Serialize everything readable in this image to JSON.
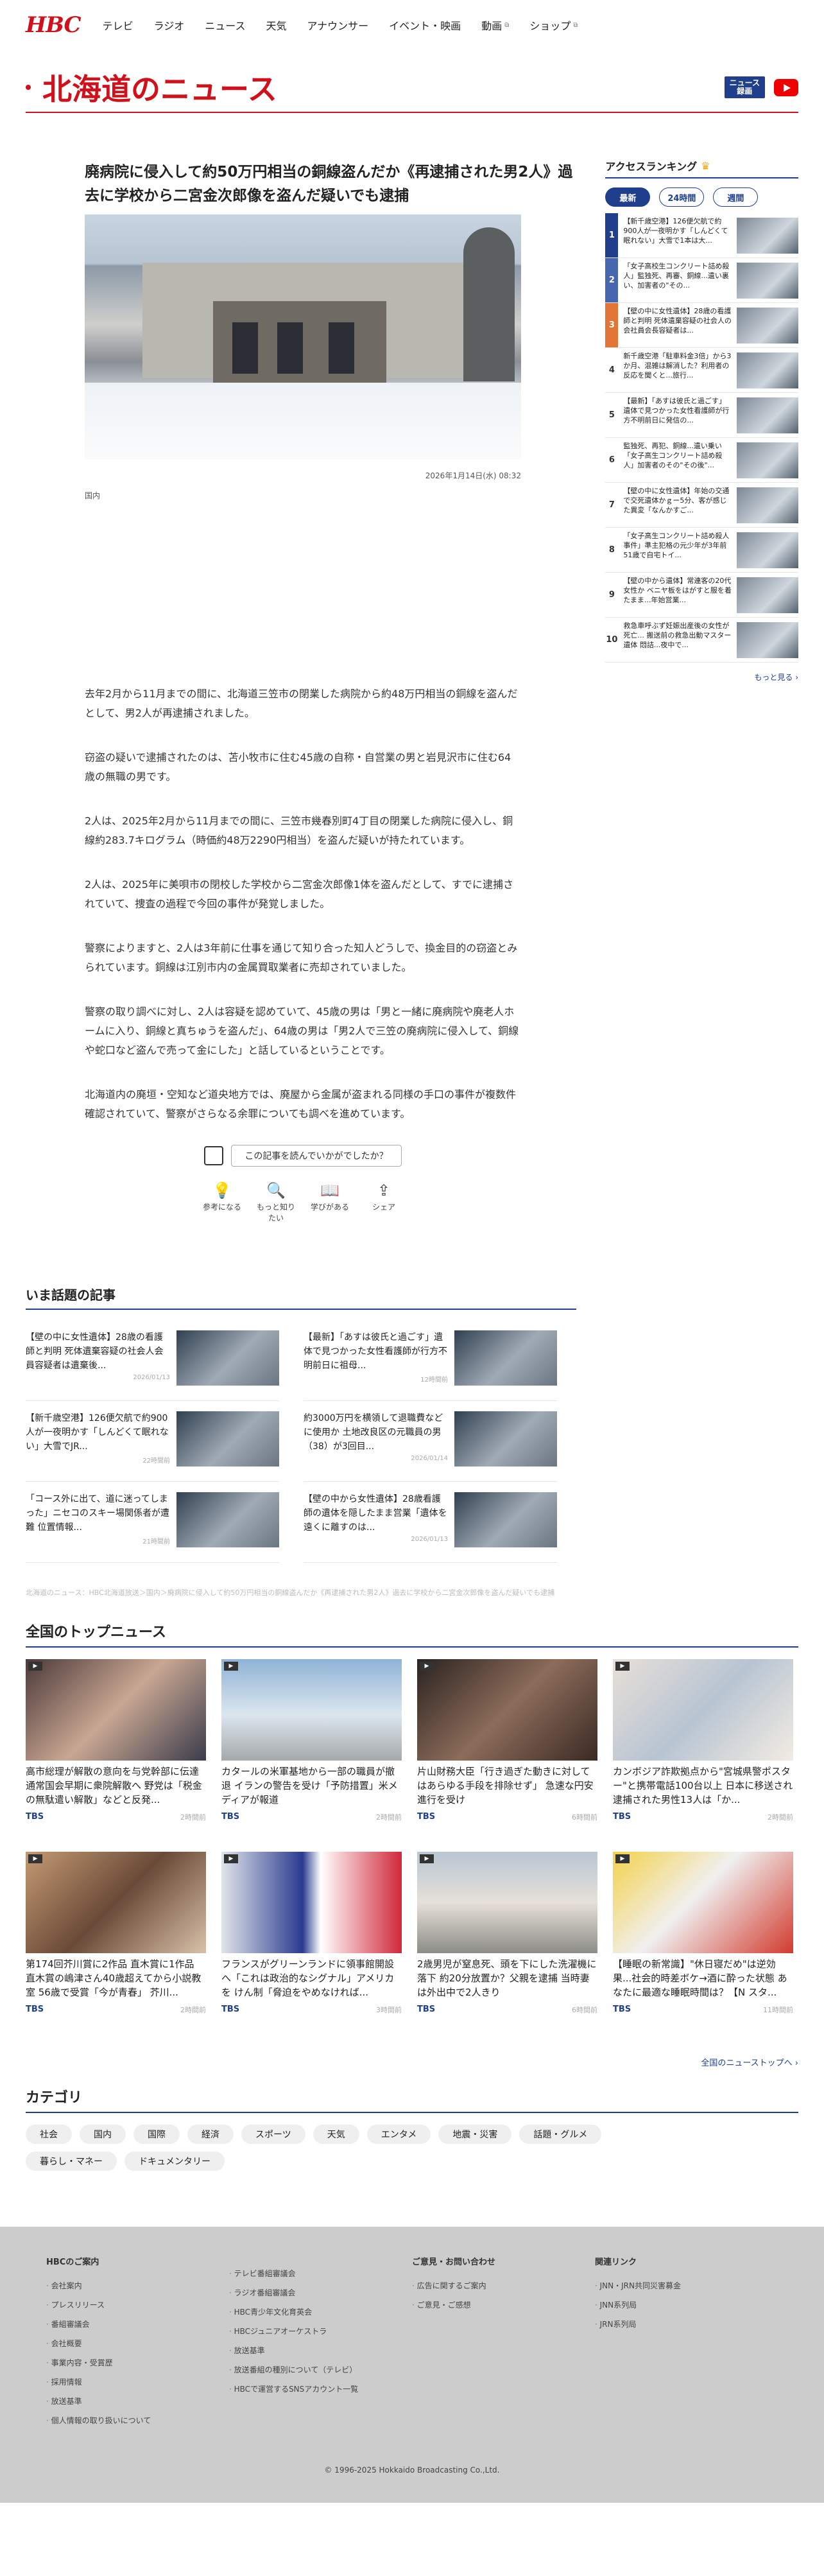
{
  "header": {
    "logo": "HBC",
    "nav": [
      {
        "label": "テレビ",
        "ext": false
      },
      {
        "label": "ラジオ",
        "ext": false
      },
      {
        "label": "ニュース",
        "ext": false
      },
      {
        "label": "天気",
        "ext": false
      },
      {
        "label": "アナウンサー",
        "ext": false
      },
      {
        "label": "イベント・映画",
        "ext": false
      },
      {
        "label": "動画",
        "ext": true
      },
      {
        "label": "ショップ",
        "ext": true
      }
    ],
    "ext_icon": "⧉"
  },
  "page": {
    "title": "北海道のニュース",
    "news_badge_1": "ニュース",
    "news_badge_2": "録画"
  },
  "article": {
    "headline": "廃病院に侵入して約50万円相当の銅線盗んだか《再逮捕された男2人》過去に学校から二宮金次郎像を盗んだ疑いでも逮捕",
    "date": "2026年1月14日(水) 08:32",
    "category": "国内",
    "paragraphs": [
      "去年2月から11月までの間に、北海道三笠市の閉業した病院から約48万円相当の銅線を盗んだとして、男2人が再逮捕されました。",
      "窃盗の疑いで逮捕されたのは、苫小牧市に住む45歳の自称・自営業の男と岩見沢市に住む64歳の無職の男です。",
      "2人は、2025年2月から11月までの間に、三笠市幾春別町4丁目の閉業した病院に侵入し、銅線約283.7キログラム（時価約48万2290円相当）を盗んだ疑いが持たれています。",
      "2人は、2025年に美唄市の閉校した学校から二宮金次郎像1体を盗んだとして、すでに逮捕されていて、捜査の過程で今回の事件が発覚しました。",
      "警察によりますと、2人は3年前に仕事を通じて知り合った知人どうしで、換金目的の窃盗とみられています。銅線は江別市内の金属買取業者に売却されていました。",
      "警察の取り調べに対し、2人は容疑を認めていて、45歳の男は「男と一緒に廃病院や廃老人ホームに入り、銅線と真ちゅうを盗んだ」、64歳の男は「男2人で三笠の廃病院に侵入して、銅線や蛇口など盗んで売って金にした」と話しているということです。",
      "北海道内の廃垣・空知など道央地方では、廃屋から金属が盗まれる同様の手口の事件が複数件確認されていて、警察がさらなる余罪についても調べを進めています。"
    ],
    "feedback_question": "この記事を読んでいかがでしたか？",
    "reactions": [
      {
        "icon": "💡",
        "label": "参考になる"
      },
      {
        "icon": "🔍",
        "label": "もっと知りたい"
      },
      {
        "icon": "📖",
        "label": "学びがある"
      },
      {
        "icon": "⇪",
        "label": "シェア"
      }
    ]
  },
  "ranking": {
    "title": "アクセスランキング",
    "tabs": [
      "最新",
      "24時間",
      "週間"
    ],
    "items": [
      {
        "num": "1",
        "text": "【新千歳空港】126便欠航で約900人が一夜明かす「しんどくて眠れない」大雪で1本は大..."
      },
      {
        "num": "2",
        "text": "「女子高校生コンクリート詰め殺人」監独死、再審、銅線...遺い裏い、加害者の\"その..."
      },
      {
        "num": "3",
        "text": "【壁の中に女性遺体】28歳の看護師と判明 死体遺棄容疑の社会人の会社員会長容疑者は..."
      },
      {
        "num": "4",
        "text": "新千歳空港「駐車料金3倍」から3か月、混雑は解消した？利用者の反応を聞くと...旅行..."
      },
      {
        "num": "5",
        "text": "【最新】「あすは彼氏と過ごす」遺体で見つかった女性看護師が行方不明前日に発信の..."
      },
      {
        "num": "6",
        "text": "監独死、再犯、銅線...遺い乗い「女子高生コンクリート詰め殺人」加害者のその\"その後\"..."
      },
      {
        "num": "7",
        "text": "【壁の中に女性遺体】年始の交通で交死遺体かｇー5分、客が感じた異変「なんかすご..."
      },
      {
        "num": "8",
        "text": "「女子高生コンクリート詰め殺人事件」準主犯格の元少年が3年前51歳で自宅トイ..."
      },
      {
        "num": "9",
        "text": "【壁の中から遺体】常連客の20代女性か ベニヤ板をはがすと服を着たまま...年始営業..."
      },
      {
        "num": "10",
        "text": "救急車呼ぶず妊娠出産後の女性が死亡... 搬送前の救急出動マスター遺体 悶詰...夜中で..."
      }
    ],
    "more": "もっと見る ›"
  },
  "trending": {
    "title": "いま話題の記事",
    "items": [
      {
        "text": "【壁の中に女性遺体】28歳の看護師と判明 死体遺棄容疑の社会人会員容疑者は遺棄後...",
        "date": "2026/01/13"
      },
      {
        "text": "【最新】「あすは彼氏と過ごす」遺体で見つかった女性看護師が行方不明前日に祖母...",
        "date": "12時間前"
      },
      {
        "text": "【新千歳空港】126便欠航で約900人が一夜明かす「しんどくて眠れない」大雪でJR...",
        "date": "22時間前"
      },
      {
        "text": "約3000万円を横領して退職費などに使用か 土地改良区の元職員の男（38）が3回目...",
        "date": "2026/01/14"
      },
      {
        "text": "「コース外に出て、道に迷ってしまった」ニセコのスキー場関係者が遭難 位置情報...",
        "date": "21時間前"
      },
      {
        "text": "【壁の中から女性遺体】28歳看護師の遺体を隠したまま営業「遺体を遠くに離すのは...",
        "date": "2026/01/13"
      }
    ]
  },
  "breadcrumb": "北海道のニュース：HBC北海道放送＞国内＞廃病院に侵入して約50万円相当の銅線盗んだか《再逮捕された男2人》過去に学校から二宮金次郎像を盗んだ疑いでも逮捕",
  "topnews": {
    "title": "全国のトップニュース",
    "items": [
      {
        "text": "高市総理が解散の意向を与党幹部に伝達 通常国会早期に衆院解散へ 野党は「税金の無駄遣い解散」などと反発...",
        "source": "TBS",
        "ago": "2時間前"
      },
      {
        "text": "カタールの米軍基地から一部の職員が撤退 イランの警告を受け「予防措置」米メディアが報道",
        "source": "TBS",
        "ago": "2時間前"
      },
      {
        "text": "片山財務大臣「行き過ぎた動きに対してはあらゆる手段を排除せず」 急速な円安進行を受け",
        "source": "TBS",
        "ago": "6時間前"
      },
      {
        "text": "カンボジア詐欺拠点から\"宮城県警ポスター\"と携帯電話100台以上 日本に移送され逮捕された男性13人は「か...",
        "source": "TBS",
        "ago": "2時間前"
      },
      {
        "text": "第174回芥川賞に2作品 直木賞に1作品 直木賞の嶋津さん40歳超えてから小説教室 56歳で受賞「今が青春」 芥川...",
        "source": "TBS",
        "ago": "2時間前"
      },
      {
        "text": "フランスがグリーンランドに領事館開設へ「これは政治的なシグナル」アメリカを けん制「脅迫をやめなければ...",
        "source": "TBS",
        "ago": "3時間前"
      },
      {
        "text": "2歳男児が窒息死、頭を下にした洗濯機に落下 約20分放置か？父親を逮捕 当時妻は外出中で2人きり",
        "source": "TBS",
        "ago": "6時間前"
      },
      {
        "text": "【睡眠の新常識】\"休日寝だめ\"は逆効果...社会的時差ボケ→酒に酔った状態 あなたに最適な睡眠時間は？【N スタ...",
        "source": "TBS",
        "ago": "11時間前"
      }
    ],
    "all_link": "全国のニューストップへ ›"
  },
  "categories": {
    "title": "カテゴリ",
    "items": [
      "社会",
      "国内",
      "国際",
      "経済",
      "スポーツ",
      "天気",
      "エンタメ",
      "地震・災害",
      "話題・グルメ",
      "暮らし・マネー",
      "ドキュメンタリー"
    ]
  },
  "footer": {
    "col1_title": "HBCのご案内",
    "col1": [
      "会社案内",
      "プレスリリース",
      "番組審議会",
      "会社概要",
      "事業内容・受賞歴",
      "採用情報",
      "放送基準",
      "個人情報の取り扱いについて"
    ],
    "col2_title": "",
    "col2": [
      "テレビ番組審議会",
      "ラジオ番組審議会",
      "HBC青少年文化育英会",
      "HBCジュニアオーケストラ",
      "放送基準",
      "放送番組の種別について（テレビ）",
      "HBCで運営するSNSアカウント一覧"
    ],
    "col3_title": "ご意見・お問い合わせ",
    "col3": [
      "広告に関するご案内",
      "ご意見・ご感想"
    ],
    "col4_title": "関連リンク",
    "col4": [
      "JNN・JRN共同災害募金",
      "JNN系列局",
      "JRN系列局"
    ],
    "copyright": "© 1996-2025 Hokkaido Broadcasting Co.,Ltd."
  }
}
